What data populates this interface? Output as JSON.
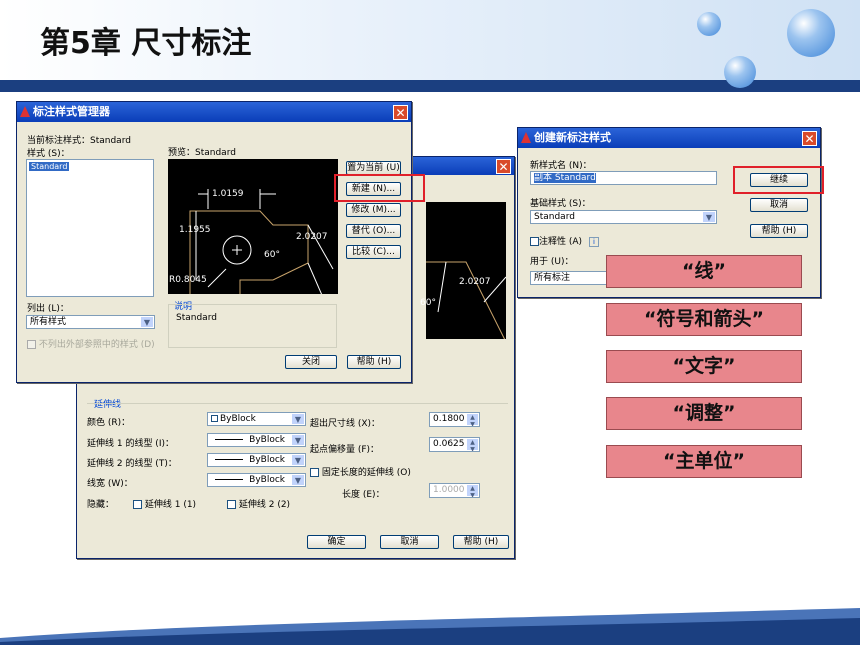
{
  "slide_title": "第5章  尺寸标注",
  "back_dialog": {
    "group_label": "延伸线",
    "color_label": "颜色 (R)：",
    "color_value": "ByBlock",
    "ext1_label": "延伸线 1 的线型 (I)：",
    "ext1_value": "ByBlock",
    "ext2_label": "延伸线 2 的线型 (T)：",
    "ext2_value": "ByBlock",
    "lineweight_label": "线宽 (W)：",
    "lineweight_value": "ByBlock",
    "hide_label": "隐藏：",
    "hide_ext1": "延伸线 1 (1)",
    "hide_ext2": "延伸线 2 (2)",
    "extend_label": "超出尺寸线 (X)：",
    "extend_value": "0.1800",
    "offset_label": "起点偏移量 (F)：",
    "offset_value": "0.0625",
    "fixed_label": "固定长度的延伸线 (O)",
    "length_label": "长度 (E)：",
    "length_value": "1.0000",
    "ok": "确定",
    "cancel": "取消",
    "help": "帮助 (H)",
    "preview_dim1": "2.0207",
    "preview_angle": "60°"
  },
  "main_dialog": {
    "title": "标注样式管理器",
    "current_style_label": "当前标注样式：Standard",
    "styles_label": "样式 (S)：",
    "styles": [
      "Standard"
    ],
    "preview_label": "预览：Standard",
    "buttons": {
      "set_current": "置为当前 (U)",
      "new": "新建 (N)...",
      "modify": "修改 (M)...",
      "override": "替代 (O)...",
      "compare": "比较 (C)..."
    },
    "list_label": "列出 (L)：",
    "list_value": "所有样式",
    "no_external_label": "不列出外部参照中的样式 (D)",
    "description_label": "说明",
    "description_value": "Standard",
    "close": "关闭",
    "help": "帮助 (H)",
    "preview": {
      "dim_top": "1.0159",
      "dim_left": "1.1955",
      "dim_right": "2.0207",
      "angle": "60°",
      "radius": "R0.8045"
    }
  },
  "new_dialog": {
    "title": "创建新标注样式",
    "new_name_label": "新样式名 (N)：",
    "new_name_value": "副本 Standard",
    "base_label": "基础样式 (S)：",
    "base_value": "Standard",
    "annotative_label": "注释性 (A)",
    "use_for_label": "用于 (U)：",
    "use_for_value": "所有标注",
    "continue": "继续",
    "cancel": "取消",
    "help": "帮助 (H)"
  },
  "tabs_buttons": [
    "“线”",
    "“符号和箭头”",
    "“文字”",
    "“调整”",
    "“主单位”"
  ],
  "colors": {
    "header_bar": "#1b3f80",
    "highlight": "#e0202a",
    "pink_button": "#e8868c"
  }
}
